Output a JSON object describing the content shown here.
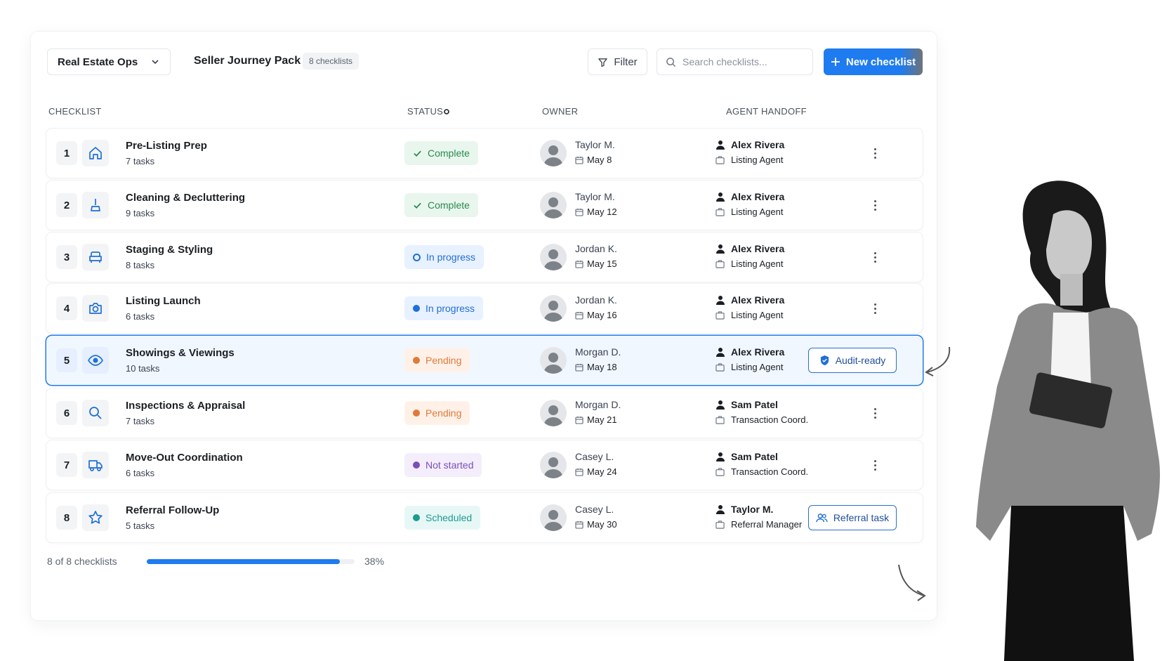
{
  "toolbar": {
    "workspace": "Real Estate Ops",
    "pack_title": "Seller Journey Pack",
    "pack_count": "8 checklists",
    "filter_label": "Filter",
    "search_placeholder": "Search checklists...",
    "new_label": "New checklist"
  },
  "columns": {
    "checklist": "CHECKLIST",
    "status": "STATUS",
    "owner": "OWNER",
    "handoff": "AGENT HANDOFF"
  },
  "rows": [
    {
      "num": "1",
      "icon": "home-icon",
      "title": "Pre-Listing Prep",
      "tasks": "7 tasks",
      "status": "Complete",
      "status_kind": "complete",
      "owner": "Taylor M.",
      "date": "May 8",
      "agent": "Alex Rivera",
      "role": "Listing Agent"
    },
    {
      "num": "2",
      "icon": "broom-icon",
      "title": "Cleaning & Decluttering",
      "tasks": "9 tasks",
      "status": "Complete",
      "status_kind": "complete",
      "owner": "Taylor M.",
      "date": "May 12",
      "agent": "Alex Rivera",
      "role": "Listing Agent"
    },
    {
      "num": "3",
      "icon": "armchair-icon",
      "title": "Staging & Styling",
      "tasks": "8 tasks",
      "status": "In progress",
      "status_kind": "progress-ring",
      "owner": "Jordan K.",
      "date": "May 15",
      "agent": "Alex Rivera",
      "role": "Listing Agent"
    },
    {
      "num": "4",
      "icon": "camera-icon",
      "title": "Listing Launch",
      "tasks": "6 tasks",
      "status": "In progress",
      "status_kind": "progress",
      "owner": "Jordan K.",
      "date": "May 16",
      "agent": "Alex Rivera",
      "role": "Listing Agent"
    },
    {
      "num": "5",
      "icon": "eye-icon",
      "title": "Showings & Viewings",
      "tasks": "10 tasks",
      "status": "Pending",
      "status_kind": "pending",
      "owner": "Morgan D.",
      "date": "May 18",
      "agent": "Alex Rivera",
      "role": "Listing Agent",
      "action": "Audit-ready"
    },
    {
      "num": "6",
      "icon": "search-icon",
      "title": "Inspections & Appraisal",
      "tasks": "7 tasks",
      "status": "Pending",
      "status_kind": "pending",
      "owner": "Morgan D.",
      "date": "May 21",
      "agent": "Sam Patel",
      "role": "Transaction Coord."
    },
    {
      "num": "7",
      "icon": "truck-icon",
      "title": "Move-Out Coordination",
      "tasks": "6 tasks",
      "status": "Not started",
      "status_kind": "notstarted",
      "owner": "Casey L.",
      "date": "May 24",
      "agent": "Sam Patel",
      "role": "Transaction Coord."
    },
    {
      "num": "8",
      "icon": "star-icon",
      "title": "Referral Follow-Up",
      "tasks": "5 tasks",
      "status": "Scheduled",
      "status_kind": "scheduled",
      "owner": "Casey L.",
      "date": "May 30",
      "agent": "Taylor M.",
      "role": "Referral Manager",
      "action": "Referral task"
    }
  ],
  "footer": {
    "count": "8 of 8 checklists",
    "percent_label": "38%",
    "progress": 0.93
  },
  "colors": {
    "accent": "#1f7bf0",
    "complete": "#2a8a4e",
    "progress": "#1f6fd6",
    "pending": "#e07a3a",
    "notstarted": "#7a4fb8",
    "scheduled": "#1f9a90"
  }
}
